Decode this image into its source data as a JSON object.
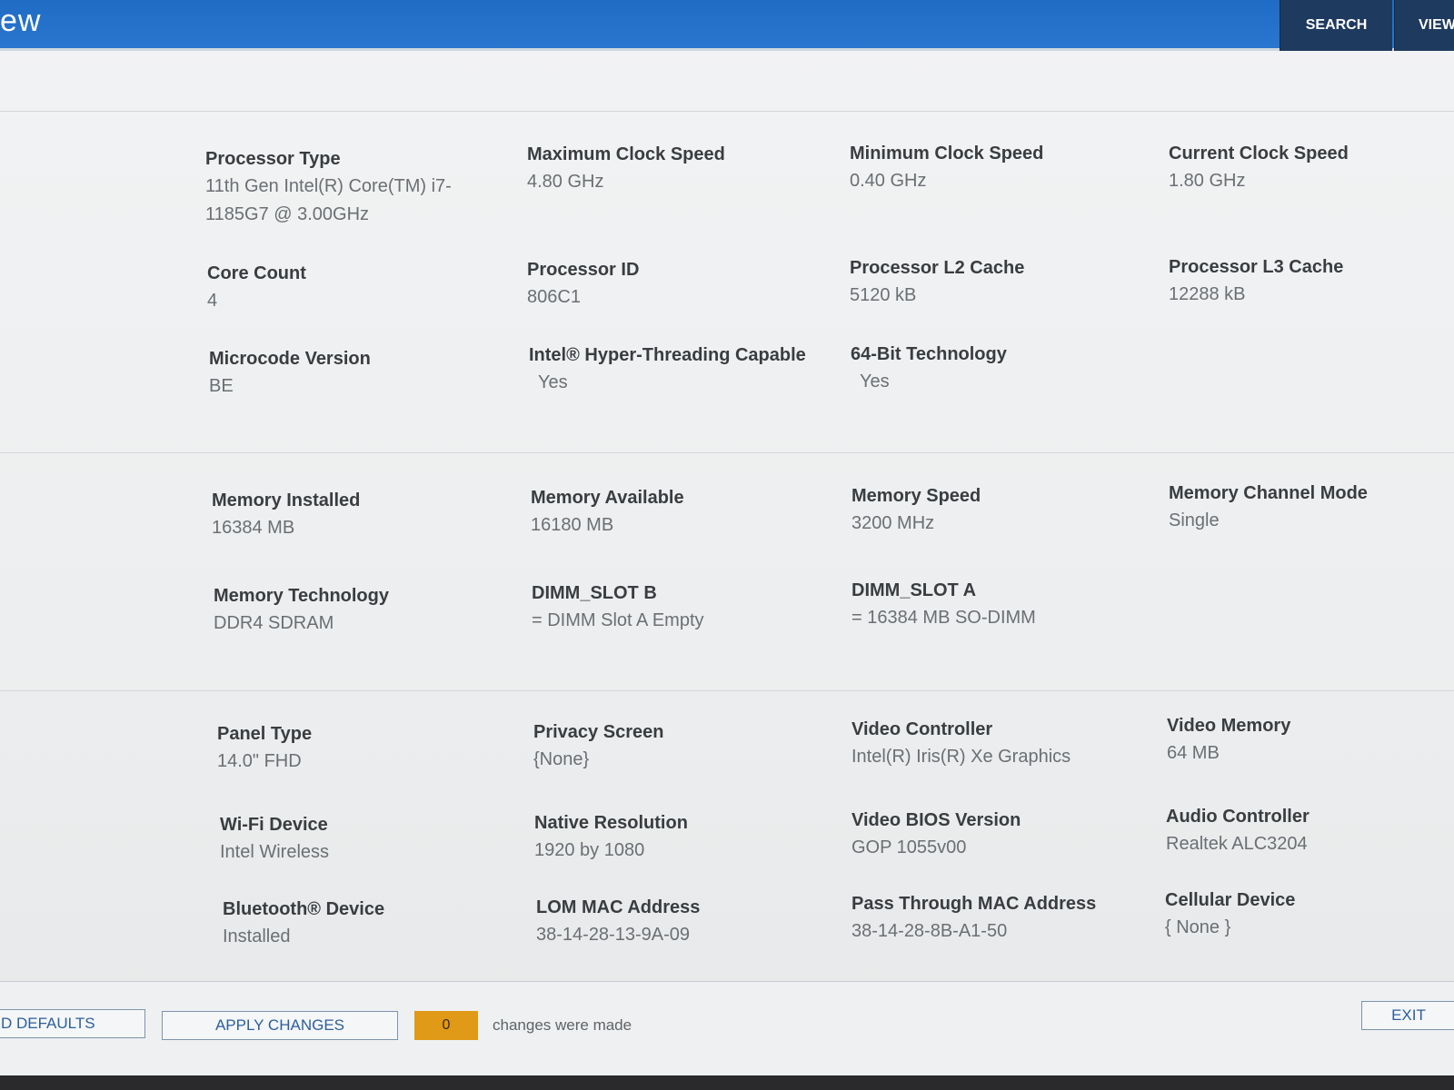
{
  "header": {
    "title": "ew",
    "search_label": "SEARCH",
    "view_label": "VIEW"
  },
  "processor": {
    "type_label": "Processor Type",
    "type_value": "11th Gen Intel(R) Core(TM) i7-1185G7 @ 3.00GHz",
    "max_clock_label": "Maximum Clock Speed",
    "max_clock_value": "4.80 GHz",
    "min_clock_label": "Minimum Clock Speed",
    "min_clock_value": "0.40 GHz",
    "cur_clock_label": "Current Clock Speed",
    "cur_clock_value": "1.80 GHz",
    "core_count_label": "Core Count",
    "core_count_value": "4",
    "id_label": "Processor ID",
    "id_value": "806C1",
    "l2_label": "Processor L2 Cache",
    "l2_value": "5120 kB",
    "l3_label": "Processor L3 Cache",
    "l3_value": "12288 kB",
    "microcode_label": "Microcode Version",
    "microcode_value": "BE",
    "ht_label": "Intel® Hyper-Threading Capable",
    "ht_value": "Yes",
    "bit64_label": "64-Bit Technology",
    "bit64_value": "Yes"
  },
  "memory": {
    "installed_label": "Memory Installed",
    "installed_value": "16384 MB",
    "available_label": "Memory Available",
    "available_value": "16180 MB",
    "speed_label": "Memory Speed",
    "speed_value": "3200 MHz",
    "channel_label": "Memory Channel Mode",
    "channel_value": "Single",
    "tech_label": "Memory Technology",
    "tech_value": "DDR4 SDRAM",
    "slot_b_label": "DIMM_SLOT B",
    "slot_b_value": "= DIMM Slot A Empty",
    "slot_a_label": "DIMM_SLOT A",
    "slot_a_value": "= 16384 MB SO-DIMM"
  },
  "devices": {
    "panel_label": "Panel Type",
    "panel_value": "14.0\" FHD",
    "privacy_label": "Privacy Screen",
    "privacy_value": "{None}",
    "video_ctrl_label": "Video Controller",
    "video_ctrl_value": "Intel(R) Iris(R) Xe Graphics",
    "video_mem_label": "Video Memory",
    "video_mem_value": "64 MB",
    "wifi_label": "Wi-Fi Device",
    "wifi_value": "Intel Wireless",
    "resolution_label": "Native Resolution",
    "resolution_value": "1920 by 1080",
    "vbios_label": "Video BIOS Version",
    "vbios_value": "GOP 1055v00",
    "audio_label": "Audio Controller",
    "audio_value": "Realtek ALC3204",
    "bt_label": "Bluetooth® Device",
    "bt_value": "Installed",
    "lom_label": "LOM MAC Address",
    "lom_value": "38-14-28-13-9A-09",
    "passthru_label": "Pass Through MAC Address",
    "passthru_value": "38-14-28-8B-A1-50",
    "cellular_label": "Cellular Device",
    "cellular_value": "{ None }"
  },
  "footer": {
    "defaults_label": "D DEFAULTS",
    "apply_label": "APPLY CHANGES",
    "changes_count": "0",
    "changes_text": "changes were made",
    "exit_label": "EXIT"
  },
  "colors": {
    "header_blue": "#1f6cc4",
    "header_button": "#1e3a5f",
    "changes_badge": "#e09a17"
  }
}
